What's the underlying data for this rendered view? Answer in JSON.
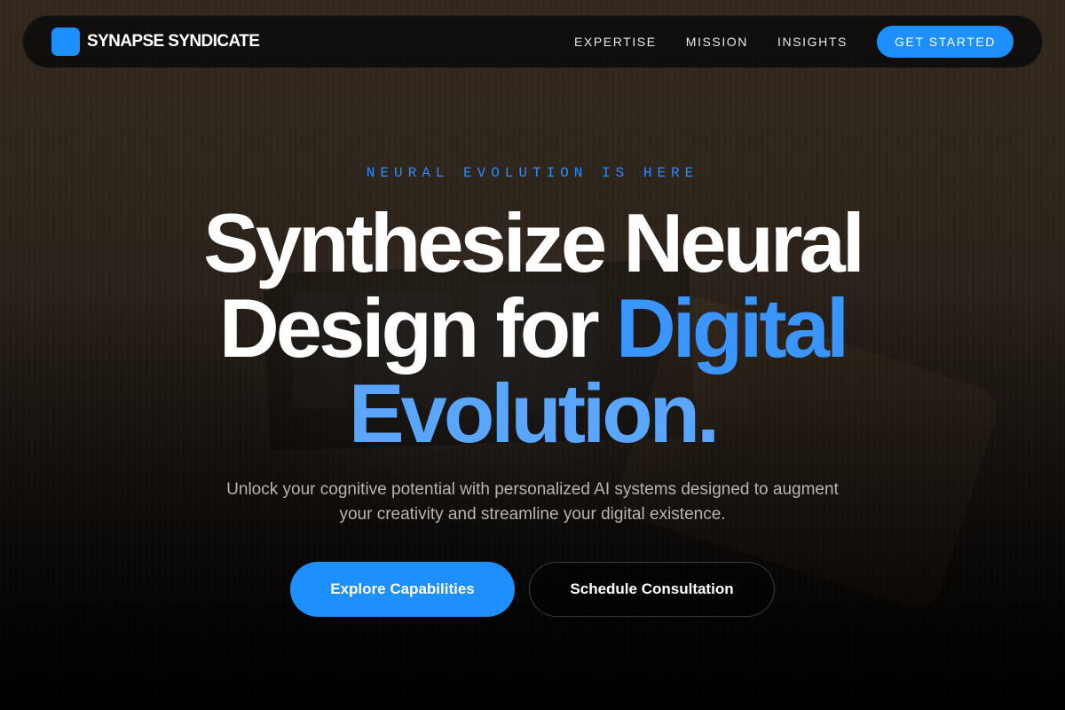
{
  "nav": {
    "brand": "SYNAPSE SYNDICATE",
    "links": [
      "EXPERTISE",
      "MISSION",
      "INSIGHTS"
    ],
    "cta_label": "GET STARTED"
  },
  "hero": {
    "eyebrow": "NEURAL EVOLUTION IS HERE",
    "headline_line1": "Synthesize Neural",
    "headline_line2_plain": "Design for ",
    "headline_line2_accent": "Digital",
    "headline_line3_accent": "Evolution.",
    "subtitle": "Unlock your cognitive potential with personalized AI systems designed to augment your creativity and streamline your digital existence.",
    "primary_button": "Explore Capabilities",
    "secondary_button": "Schedule Consultation"
  },
  "colors": {
    "accent": "#1e8fff",
    "background": "#0b0908",
    "text": "#ffffff"
  }
}
